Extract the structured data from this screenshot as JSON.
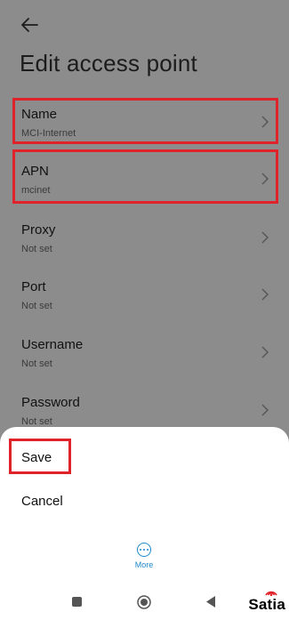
{
  "header": {
    "title": "Edit access point"
  },
  "fields": [
    {
      "label": "Name",
      "value": "MCI-Internet"
    },
    {
      "label": "APN",
      "value": "mcinet"
    },
    {
      "label": "Proxy",
      "value": "Not set"
    },
    {
      "label": "Port",
      "value": "Not set"
    },
    {
      "label": "Username",
      "value": "Not set"
    },
    {
      "label": "Password",
      "value": "Not set"
    }
  ],
  "sheet": {
    "save_label": "Save",
    "cancel_label": "Cancel",
    "more_label": "More"
  },
  "branding": {
    "logo_text": "Satia"
  },
  "colors": {
    "highlight": "#e0222a",
    "accent": "#1e88c8",
    "scrim": "#8c8c8c"
  }
}
